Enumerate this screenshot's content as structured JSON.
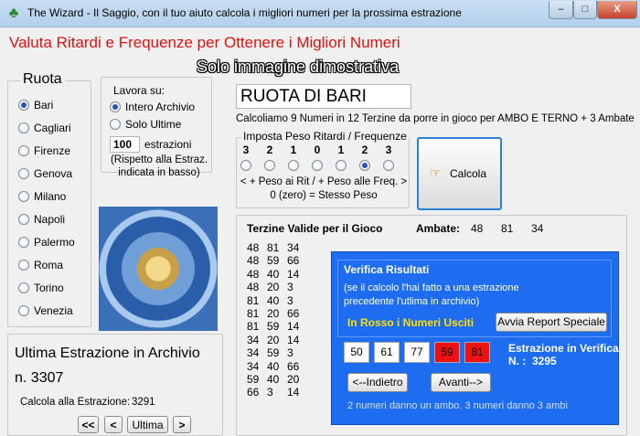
{
  "window": {
    "title": "The Wizard - Il Saggio, con il tuo aiuto calcola i migliori numeri per la prossima estrazione",
    "controls": [
      "–",
      "□",
      "X"
    ]
  },
  "header": {
    "title": "Valuta Ritardi e Frequenze per Ottenere i Migliori Numeri",
    "watermark": "Solo immagine dimostrativa"
  },
  "ruota": {
    "label": "Ruota",
    "items": [
      "Bari",
      "Cagliari",
      "Firenze",
      "Genova",
      "Milano",
      "Napoli",
      "Palermo",
      "Roma",
      "Torino",
      "Venezia"
    ],
    "selected": "Bari"
  },
  "lavora": {
    "label": "Lavora su:",
    "options": [
      "Intero Archivio",
      "Solo Ultime"
    ],
    "selected": "Intero Archivio",
    "count_value": "100",
    "count_label": "estrazioni",
    "note": "(Rispetto alla  Estraz. indicata in basso)"
  },
  "archivio": {
    "title": "Ultima Estrazione in Archivio",
    "number": "n. 3307",
    "calcola_label": "Calcola alla Estrazione:",
    "calcola_value": "3291",
    "nav": [
      "<<",
      "<",
      "Ultima",
      ">"
    ]
  },
  "calc": {
    "ruota_box": "RUOTA DI BARI",
    "description": "Calcoliamo 9 Numeri in  12 Terzine da porre in gioco per AMBO E TERNO + 3 Ambate",
    "peso_title": "Imposta Peso Ritardi / Frequenze",
    "peso_values": [
      "3",
      "2",
      "1",
      "0",
      "1",
      "2",
      "3"
    ],
    "peso_selected_index": 5,
    "peso_hint_1": "< + Peso ai Rit / + Peso alle Freq. >",
    "peso_hint_2": "0 (zero) = Stesso Peso",
    "calcola_button": "Calcola"
  },
  "results": {
    "terzine_title": "Terzine Valide per il Gioco",
    "ambate_label": "Ambate:",
    "ambate": [
      "48",
      "81",
      "34"
    ],
    "terzine": [
      [
        "48",
        "81",
        "34"
      ],
      [
        "48",
        "59",
        "66"
      ],
      [
        "48",
        "40",
        "14"
      ],
      [
        "48",
        "20",
        "3"
      ],
      [
        "81",
        "40",
        "3"
      ],
      [
        "81",
        "20",
        "66"
      ],
      [
        "81",
        "59",
        "14"
      ],
      [
        "34",
        "20",
        "14"
      ],
      [
        "34",
        "59",
        "3"
      ],
      [
        "34",
        "40",
        "66"
      ],
      [
        "59",
        "40",
        "20"
      ],
      [
        "66",
        "3",
        "14"
      ]
    ]
  },
  "verifica": {
    "title": "Verifica Risultati",
    "note": "(se il calcolo l'hai fatto a una estrazione precedente l'utlima in archivio)",
    "usciti": "In Rosso i Numeri Usciti",
    "report_button": "Avvia Report Speciale",
    "numbers": [
      {
        "value": "50",
        "hit": false
      },
      {
        "value": "61",
        "hit": false
      },
      {
        "value": "77",
        "hit": false
      },
      {
        "value": "59",
        "hit": true
      },
      {
        "value": "81",
        "hit": true
      }
    ],
    "estrazione_label": "Estrazione in Verifica",
    "estrazione_number": "N. :  3295",
    "prev_button": "<--Indietro",
    "next_button": "Avanti-->",
    "footer": "2 numeri danno un ambo.  3 numeri danno 3 ambi"
  },
  "colors": {
    "title_red": "#e01010",
    "panel_blue": "#1e6cf0",
    "usciti_yellow": "#ffe000",
    "hit_red": "#ee1111"
  }
}
